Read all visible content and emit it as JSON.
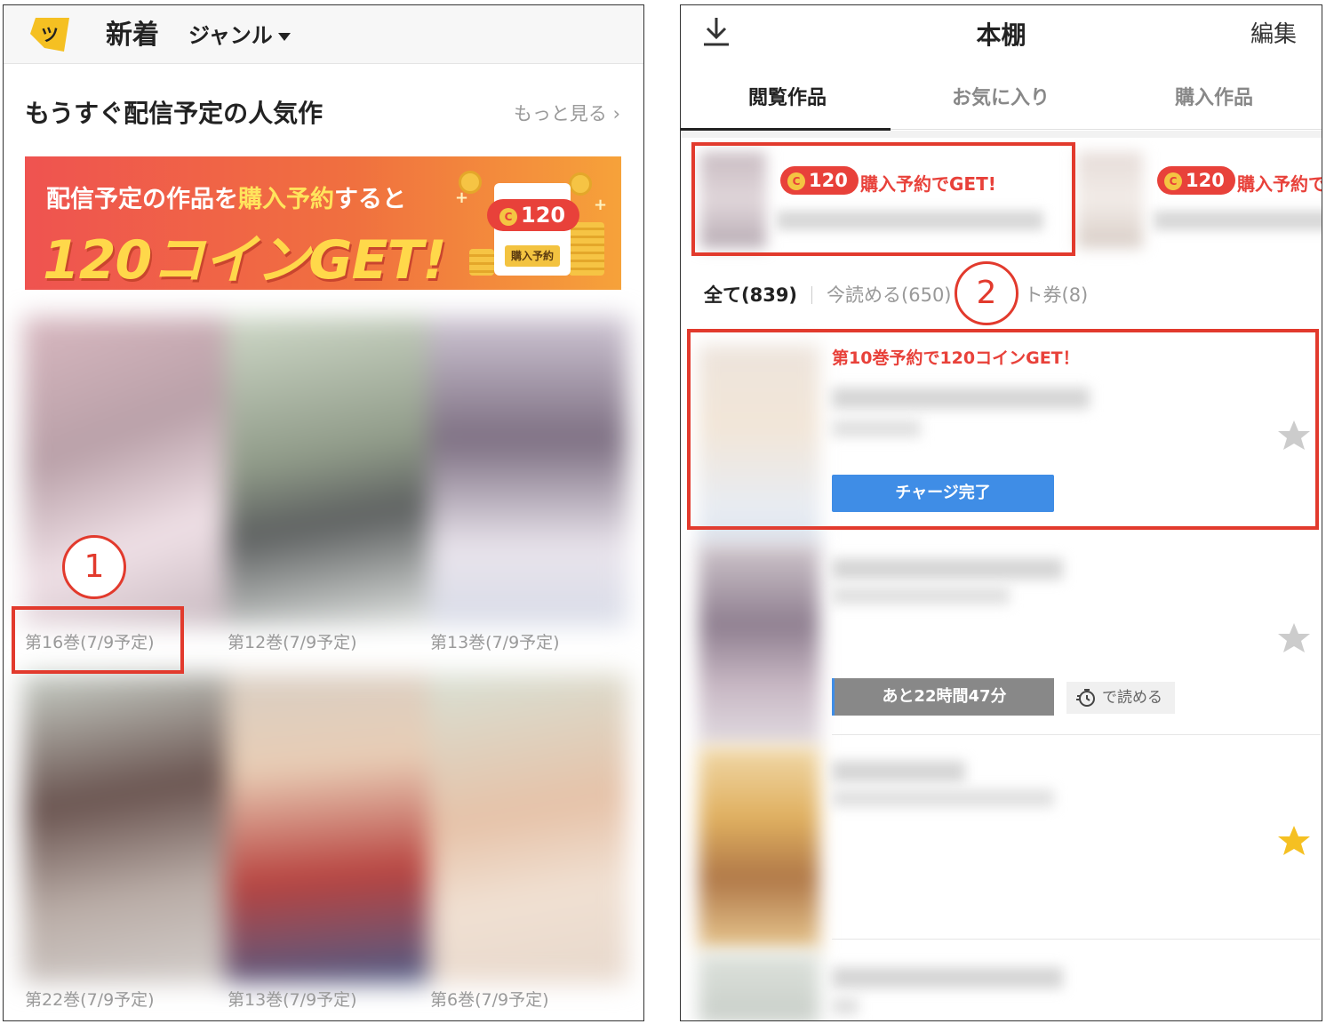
{
  "left": {
    "header": {
      "title": "新着",
      "genre": "ジャンル"
    },
    "section_title": "もうすぐ配信予定の人気作",
    "more_link": "もっと見る",
    "banner": {
      "line1_a": "配信予定の作品を",
      "line1_hl": "購入予約",
      "line1_b": "すると",
      "line2": "120コインGET!",
      "pill": "120",
      "coin": "C",
      "card_label": "購入予約"
    },
    "volumes_row1": [
      "第16巻(7/9予定)",
      "第12巻(7/9予定)",
      "第13巻(7/9予定)"
    ],
    "volumes_row2": [
      "第22巻(7/9予定)",
      "第13巻(7/9予定)",
      "第6巻(7/9予定)"
    ],
    "marker": "1"
  },
  "right": {
    "header": {
      "title": "本棚",
      "edit": "編集"
    },
    "tabs": [
      "閲覧作品",
      "お気に入り",
      "購入作品"
    ],
    "cards": [
      {
        "pill": "120",
        "text": "購入予約でGET!",
        "coin": "C"
      },
      {
        "pill": "120",
        "text": "購入予約でGET!",
        "coin": "C"
      }
    ],
    "filters": {
      "all": "全て(839)",
      "now": "今読める(650)",
      "ticket": "ト券(8)"
    },
    "marker": "2",
    "promo": "第10巻予約で120コインGET！",
    "charge_button": "チャージ完了",
    "timer": "あと22時間47分",
    "wait_label": "で読める",
    "favorites": [
      false,
      false,
      true
    ],
    "colors": {
      "accent_red": "#e8413a",
      "button_blue": "#3f8de6",
      "star_on": "#f5c022",
      "star_off": "#cccccc"
    }
  }
}
